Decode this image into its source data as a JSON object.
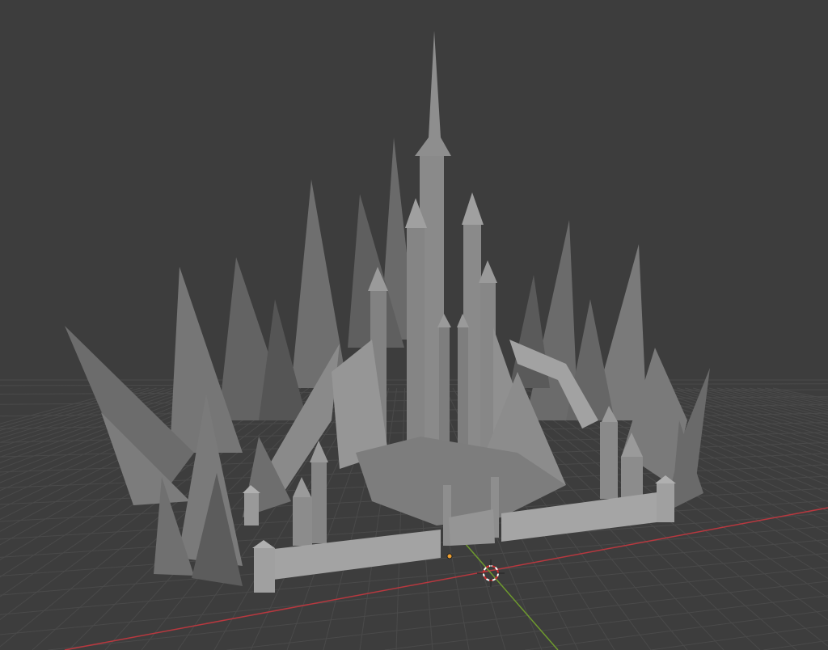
{
  "viewport": {
    "background": "#3d3d3d",
    "grid_color": "#4a4a4a",
    "x_axis_color": "#b8383f",
    "y_axis_color": "#6e9a2e",
    "model_color": "#8c8c8c"
  },
  "icons": {
    "cursor": "3d-cursor-icon",
    "origin": "object-origin-icon"
  }
}
